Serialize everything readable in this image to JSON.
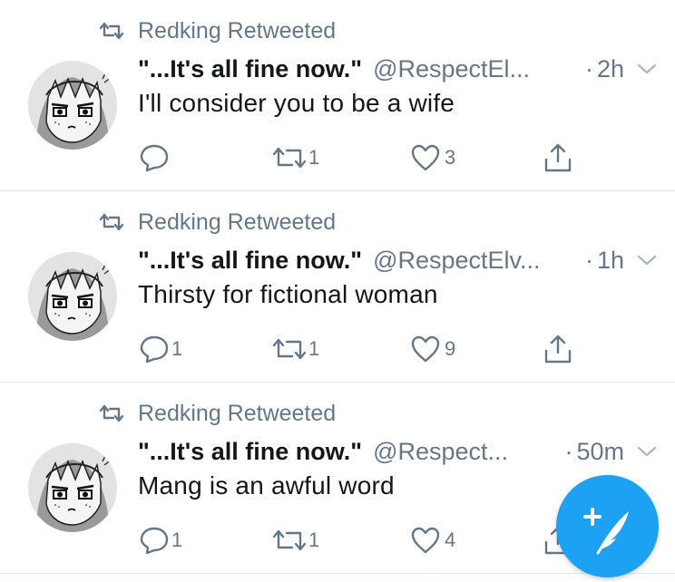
{
  "tweets": [
    {
      "retweeted_by": "Redking Retweeted",
      "display_name": "\"...It's all fine now.\"",
      "handle": "@RespectEl...",
      "dot": "·",
      "time": "2h",
      "text": "I'll consider you to be a wife",
      "reply_count": "",
      "retweet_count": "1",
      "like_count": "3"
    },
    {
      "retweeted_by": "Redking Retweeted",
      "display_name": "\"...It's all fine now.\"",
      "handle": "@RespectElv...",
      "dot": "·",
      "time": "1h",
      "text": "Thirsty for fictional woman",
      "reply_count": "1",
      "retweet_count": "1",
      "like_count": "9"
    },
    {
      "retweeted_by": "Redking Retweeted",
      "display_name": "\"...It's all fine now.\"",
      "handle": "@Respect...",
      "dot": "·",
      "time": "50m",
      "text": "Mang is an awful word",
      "reply_count": "1",
      "retweet_count": "1",
      "like_count": "4"
    }
  ],
  "colors": {
    "accent": "#1da1f2",
    "secondary_text": "#657786",
    "primary_text": "#14171a",
    "divider": "#e1e8ed"
  },
  "icons": {
    "retweet": "retweet-icon",
    "reply": "reply-icon",
    "like": "heart-icon",
    "share": "share-icon",
    "caret": "chevron-down-icon",
    "compose": "compose-tweet-icon"
  }
}
